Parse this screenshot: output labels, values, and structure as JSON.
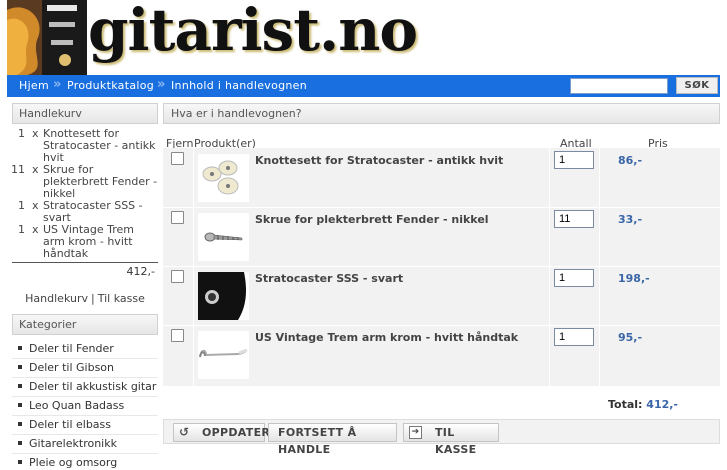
{
  "header": {
    "logo_text": "gitarist.no"
  },
  "nav": {
    "breadcrumbs": [
      "Hjem",
      "Produktkatalog",
      "Innhold i handlevognen"
    ],
    "search_button": "SØK",
    "search_value": ""
  },
  "cart_box": {
    "title": "Handlekurv",
    "items": [
      {
        "qty": "1",
        "x": "x",
        "name": "Knottesett for Stratocaster - antikk hvit"
      },
      {
        "qty": "11",
        "x": "x",
        "name": "Skrue for plekterbrett Fender - nikkel"
      },
      {
        "qty": "1",
        "x": "x",
        "name": "Stratocaster SSS - svart"
      },
      {
        "qty": "1",
        "x": "x",
        "name": "US Vintage Trem arm krom - hvitt håndtak"
      }
    ],
    "total": "412,-",
    "link_cart": "Handlekurv",
    "link_sep": "|",
    "link_checkout": "Til kasse"
  },
  "categories_box": {
    "title": "Kategorier",
    "items": [
      "Deler til Fender",
      "Deler til Gibson",
      "Deler til akkustisk gitar",
      "Leo Quan Badass",
      "Deler til elbass",
      "Gitarelektronikk",
      "Pleie og omsorg"
    ]
  },
  "main": {
    "title": "Hva er i handlevognen?",
    "columns": {
      "remove": "Fjern",
      "product": "Produkt(er)",
      "qty": "Antall",
      "price": "Pris"
    },
    "rows": [
      {
        "name": "Knottesett for Stratocaster - antikk hvit",
        "qty": "1",
        "price": "86,-",
        "thumb": "knob-set-image"
      },
      {
        "name": "Skrue for plekterbrett Fender - nikkel",
        "qty": "11",
        "price": "33,-",
        "thumb": "screw-image"
      },
      {
        "name": "Stratocaster SSS - svart",
        "qty": "1",
        "price": "198,-",
        "thumb": "pickguard-image"
      },
      {
        "name": "US Vintage Trem arm krom - hvitt håndtak",
        "qty": "1",
        "price": "95,-",
        "thumb": "trem-arm-image"
      }
    ],
    "total_label": "Total:",
    "total_value": "412,-",
    "buttons": {
      "update": "OPPDATER",
      "continue": "FORTSETT Å HANDLE",
      "checkout": "TIL KASSE"
    }
  },
  "colors": {
    "nav_bg": "#1a6fe0",
    "price": "#3a66a8"
  }
}
